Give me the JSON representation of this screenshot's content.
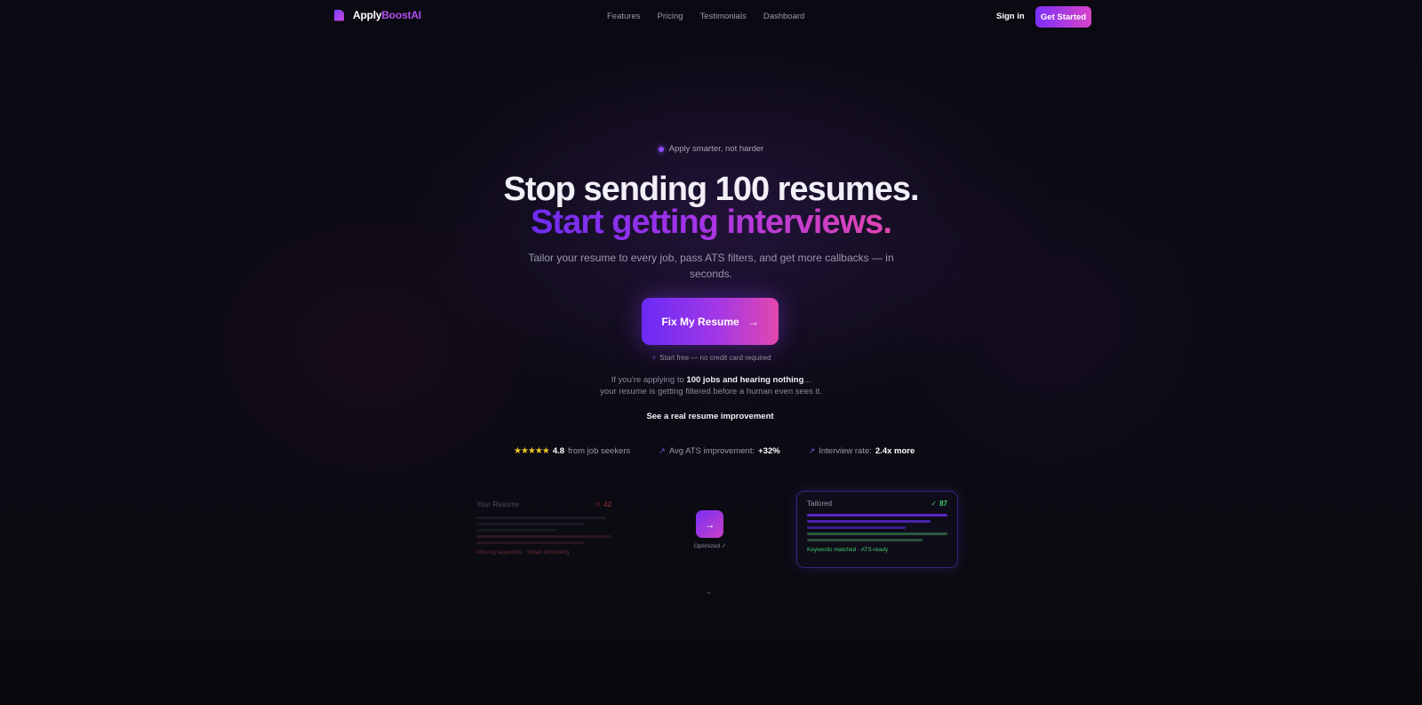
{
  "nav": {
    "brand_part1": "Apply",
    "brand_part2": "BoostAI",
    "links": [
      "Features",
      "Pricing",
      "Testimonials",
      "Dashboard"
    ],
    "signin": "Sign in",
    "get_started": "Get Started"
  },
  "hero": {
    "badge": "Apply smarter, not harder",
    "headline_1": "Stop sending 100 resumes.",
    "headline_2": "Start getting interviews.",
    "subtitle": "Tailor your resume to every job, pass ATS filters, and get more callbacks — in seconds.",
    "cta": "Fix My Resume",
    "free_note": "Start free — no credit card required",
    "pain_prefix": "If you're applying to ",
    "pain_bold": "100 jobs and hearing nothing",
    "pain_suffix": "...",
    "pain_line2": "your resume is getting filtered before a human even sees it.",
    "see_improvement": "See a real resume improvement"
  },
  "stats": {
    "rating": "4.8",
    "rating_label": "from job seekers",
    "ats_label": "Avg ATS improvement: ",
    "ats_value": "+32%",
    "interview_label": "Interview rate: ",
    "interview_value": "2.4x more"
  },
  "comparison": {
    "before_title": "Your Resume",
    "before_score": "42",
    "before_note": "Missing keywords · Weak formatting",
    "optimized_label": "Optimized ✓",
    "after_title": "Tailored",
    "after_score": "87",
    "after_note": "Keywords matched · ATS-ready"
  },
  "colors": {
    "accent_start": "#6a2af5",
    "accent_end": "#e347b0",
    "background": "#0c0b12",
    "success": "#3fd06b",
    "danger": "#d8423f"
  }
}
